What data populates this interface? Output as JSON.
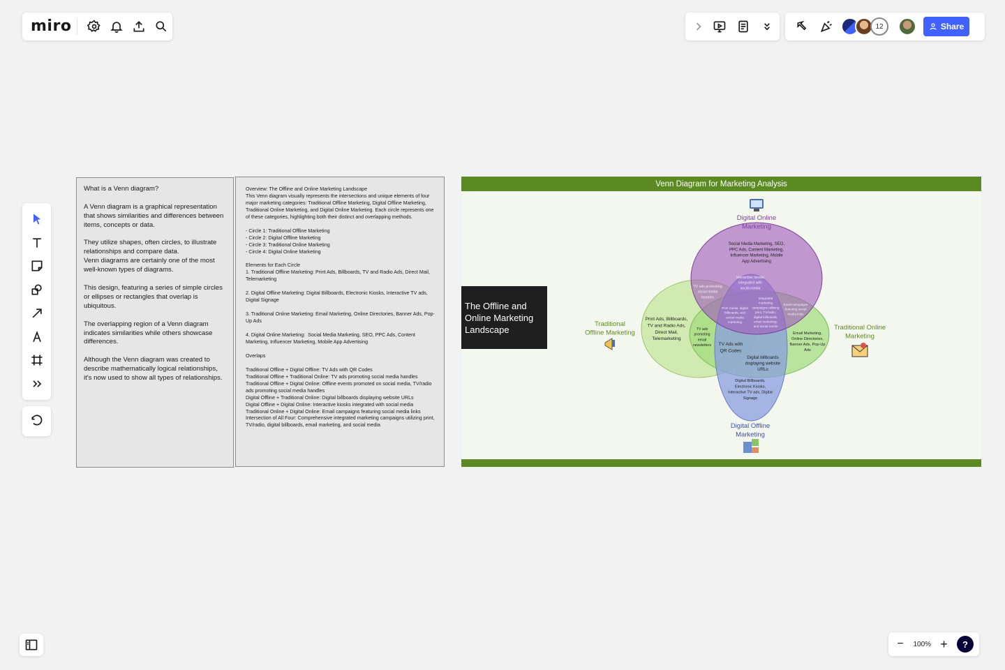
{
  "app": {
    "logo": "miro"
  },
  "toolbar": {
    "icons": [
      "settings-icon",
      "bell-icon",
      "upload-icon",
      "search-icon"
    ],
    "collaborators_count": "12",
    "share_label": "Share"
  },
  "zoom": {
    "level": "100%",
    "minus": "−",
    "plus": "+",
    "help": "?"
  },
  "card_what": {
    "text": "What is a Venn diagram?\n\nA Venn diagram is a graphical representation that shows similarities and differences between items, concepts or data.\n\nThey utilize shapes, often circles, to illustrate relationships and compare data.\nVenn diagrams are certainly one of the most well-known types of diagrams.\n\nThis design, featuring a series of simple circles or ellipses or rectangles that overlap is ubiquitous.\n\nThe overlapping region of a Venn diagram indicates similarities while others showcase differences.\n\nAlthough the Venn diagram was created to describe mathematically logical relationships, it's now used to show all types of relationships."
  },
  "card_overview": {
    "text": "Overview: The Offline and Online Marketing Landscape\nThis Venn diagram visually represents the intersections and unique elements of four major marketing categories: Traditional Offline Marketing, Digital Offline Marketing, Traditional Online Marketing, and Digital Online Marketing. Each circle represents one of these categories, highlighting both their distinct and overlapping methods.\n\n- Circle 1: Traditional Offline Marketing\n- Circle 2: Digital Offline Marketing\n- Circle 3: Traditional Online Marketing\n- Circle 4: Digital Online Marketing\n\nElements for Each Circle\n1. Traditional Offline Marketing: Print Ads, Billboards, TV and Radio Ads, Direct Mail, Telemarketing\n\n2. Digital Offline Marketing: Digital Billboards, Electronic Kiosks, Interactive TV ads, Digital Signage\n\n3. Traditional Online Marketing: Email Marketing, Online Directories, Banner Ads, Pop-Up Ads\n\n4. Digital Online Marketing:  Social Media Marketing, SEO, PPC Ads, Content Marketing, Influencer Marketing, Mobile App Advertising\n\nOverlaps\n\nTraditional Offline + Digital Offline: TV Ads with QR Codes\nTraditional Offline + Traditional Online: TV ads promoting social media handles\nTraditional Offline + Digital Online: Offline events promoted on social media, TV/radio ads promoting social media handles\nDigital Offline + Traditional Online: Digital billboards displaying website URLs\nDigital Offline + Digital Online: Interactive kiosks integrated with social media\nTraditional Online + Digital Online: Email campaigns featuring social media links\nIntersection of All Four: Comprehensive integrated marketing campaigns utilizing print, TV/radio, digital billboards, email marketing, and social media"
  },
  "venn": {
    "header": "Venn Diagram for Marketing Analysis",
    "title_box": "The Offline and Online Marketing Landscape",
    "labels": {
      "digital_online": [
        "Digital Online",
        "Marketing"
      ],
      "traditional_offline": [
        "Traditional",
        "Offline Marketing"
      ],
      "traditional_online": [
        "Traditional Online",
        "Marketing"
      ],
      "digital_offline": [
        "Digital Offline",
        "Marketing"
      ]
    },
    "regions": {
      "digital_online_only": [
        "Social Media Marketing, SEO,",
        "PPC Ads, Content Marketing,",
        "Influencer Marketing, Mobile",
        "App Advertising"
      ],
      "traditional_offline_only": [
        "Print Ads, Billboards,",
        "TV and Radio Ads,",
        "Direct Mail,",
        "Telemarketing"
      ],
      "traditional_online_only": [
        "Email Marketing,",
        "Online Directories,",
        "Banner Ads, Pop-Up",
        "Ads"
      ],
      "digital_offline_only": [
        "Digital Billboards,",
        "Electronic Kiosks,",
        "Interactive TV ads, Digital",
        "Signage"
      ],
      "tv_ads_qr": [
        "TV Ads with",
        "QR Codes"
      ],
      "tv_ads_email": [
        "TV ads",
        "promoting",
        "email",
        "newsletters"
      ],
      "billboards_urls": [
        "Digital billboards",
        "displaying website",
        "URLs"
      ],
      "tv_ads_social": [
        "TV ads promoting",
        "social media",
        "handles"
      ],
      "kiosks_social": [
        "Interactive kiosks",
        "integrated with",
        "social media"
      ],
      "print_media": [
        "Print media, digital",
        "billboards, and",
        "social media",
        "marketing"
      ],
      "integrated": [
        "Integrated",
        "marketing",
        "campaigns utilizing",
        "print, TV/radio,",
        "digital billboards,",
        "email marketing,",
        "and social media"
      ],
      "email_campaigns": [
        "Email campaigns",
        "featuring social",
        "media links"
      ]
    }
  },
  "colors": {
    "accent": "#4262ff",
    "venn_header": "#5b8a23",
    "digital_online": "#9b59b6",
    "traditional_offline": "#b6e08a",
    "traditional_online": "#8fd66b",
    "digital_offline": "#7d8fd6"
  }
}
